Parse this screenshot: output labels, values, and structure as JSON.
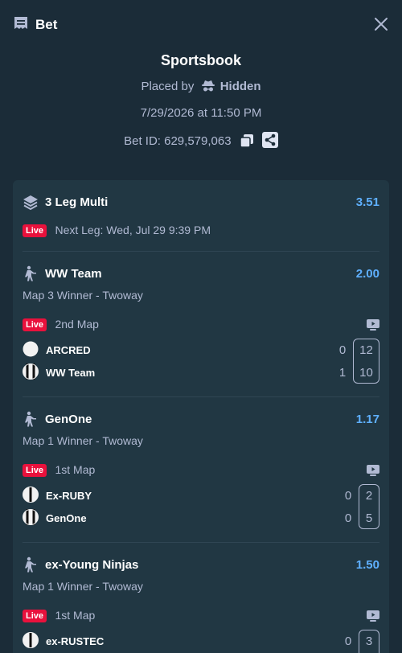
{
  "header": {
    "title": "Bet"
  },
  "summary": {
    "book": "Sportsbook",
    "placed_by_label": "Placed by",
    "placed_by_user": "Hidden",
    "date": "7/29/2026 at 11:50 PM",
    "bet_id": "Bet ID: 629,579,063"
  },
  "multi": {
    "title": "3 Leg Multi",
    "odds": "3.51",
    "live_badge": "Live",
    "next_leg": "Next Leg: Wed, Jul 29 9:39 PM"
  },
  "legs": [
    {
      "team": "WW Team",
      "odds": "2.00",
      "market": "Map 3 Winner - Twoway",
      "live_badge": "Live",
      "status": "2nd Map",
      "teams": [
        {
          "name": "ARCRED",
          "score": "0",
          "map_score": "12"
        },
        {
          "name": "WW Team",
          "score": "1",
          "map_score": "10"
        }
      ]
    },
    {
      "team": "GenOne",
      "odds": "1.17",
      "market": "Map 1 Winner - Twoway",
      "live_badge": "Live",
      "status": "1st Map",
      "teams": [
        {
          "name": "Ex-RUBY",
          "score": "0",
          "map_score": "2"
        },
        {
          "name": "GenOne",
          "score": "0",
          "map_score": "5"
        }
      ]
    },
    {
      "team": "ex-Young Ninjas",
      "odds": "1.50",
      "market": "Map 1 Winner - Twoway",
      "live_badge": "Live",
      "status": "1st Map",
      "teams": [
        {
          "name": "ex-RUSTEC",
          "score": "0",
          "map_score": "3"
        }
      ]
    }
  ],
  "colors": {
    "background": "#1b2c38",
    "card": "#213743",
    "accent_odds": "#5fb0ff",
    "live": "#e9113c",
    "muted": "#b1bad3"
  },
  "icons": [
    "bet-slip-icon",
    "close-icon",
    "incognito-icon",
    "copy-icon",
    "share-icon",
    "layers-icon",
    "counter-strike-icon",
    "tv-icon",
    "team-logo-icon"
  ]
}
